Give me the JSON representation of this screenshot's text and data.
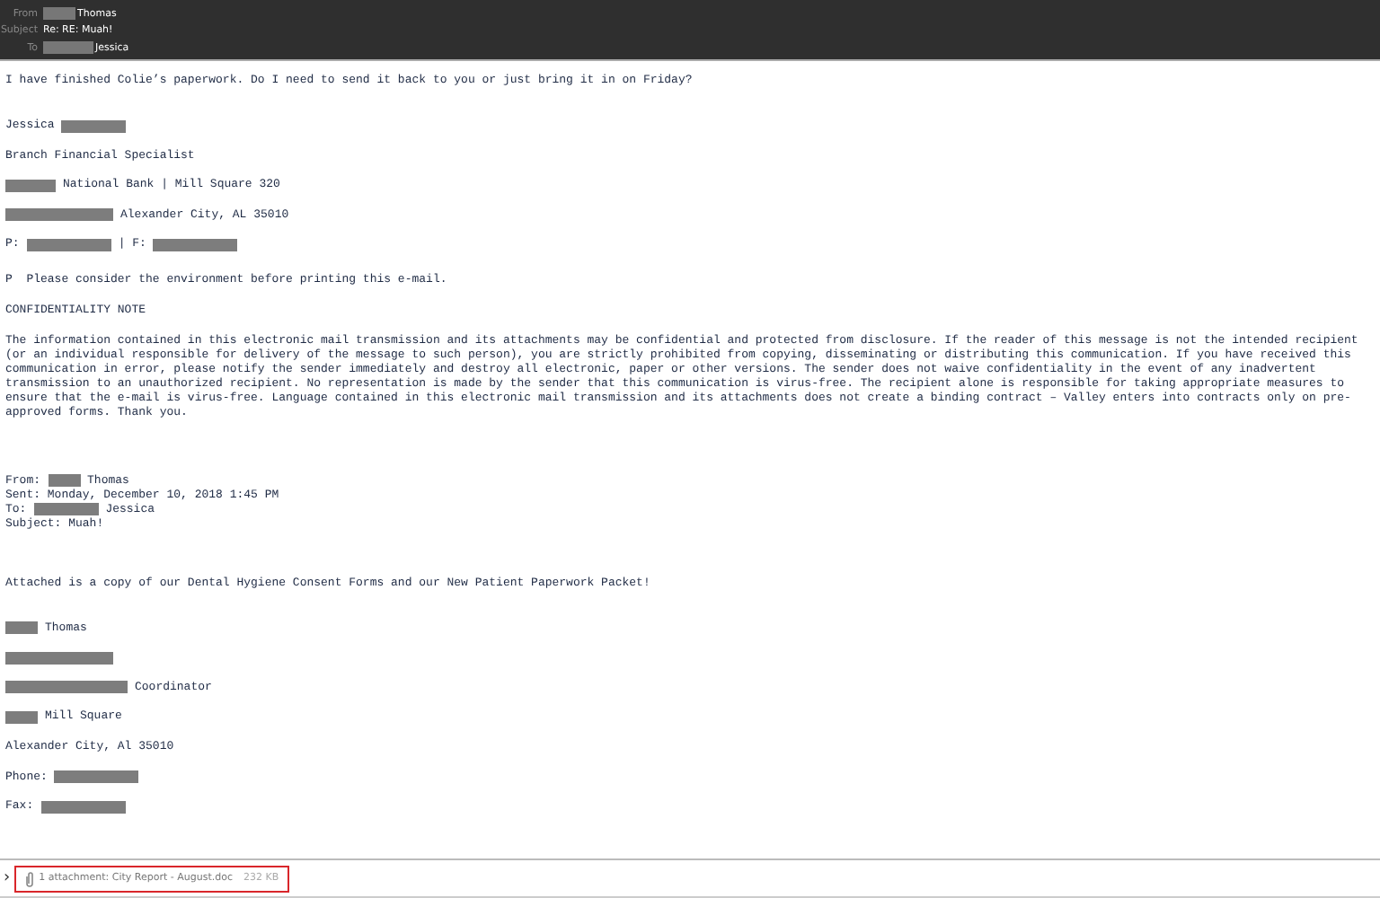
{
  "header": [
    {
      "label": "From",
      "parts": [
        {
          "kind": "small"
        },
        {
          "kind": "text",
          "text": "Thomas"
        }
      ]
    },
    {
      "label": "Subject",
      "parts": [
        {
          "kind": "text",
          "text": "Re: RE: Muah!"
        }
      ]
    },
    {
      "label": "To",
      "parts": [
        {
          "kind": "medium"
        },
        {
          "kind": "text",
          "text": "Jessica"
        }
      ]
    }
  ],
  "body": [
    {
      "kind": "spaced",
      "lines": [
        [
          {
            "kind": "text",
            "text": "I have finished Colie’s paperwork. Do I need to send it back to you or just bring it in on Friday?"
          }
        ]
      ]
    },
    {
      "kind": "spaced",
      "lines": [
        [
          {
            "kind": "text",
            "text": "Jessica"
          },
          {
            "kind": "large"
          }
        ],
        [
          {
            "kind": "text",
            "text": "Branch Financial Specialist"
          }
        ],
        [
          {
            "kind": "medium"
          },
          {
            "kind": "text",
            "text": "National Bank | Mill Square 320"
          }
        ],
        [
          {
            "kind": "wider"
          },
          {
            "kind": "text",
            "text": "Alexander City, AL 35010"
          }
        ],
        [
          {
            "kind": "text",
            "text": "P:"
          },
          {
            "kind": "wide"
          },
          {
            "kind": "text",
            "text": "| F:"
          },
          {
            "kind": "wide"
          }
        ]
      ]
    },
    {
      "kind": "spaced",
      "lines": [
        [
          {
            "kind": "text",
            "text": "P  Please consider the environment before printing this e-mail."
          }
        ],
        [
          {
            "kind": "text",
            "text": "CONFIDENTIALITY NOTE"
          }
        ]
      ]
    },
    {
      "kind": "paragraph",
      "lines": [
        "The information contained in this electronic mail transmission and its attachments may be confidential and protected from disclosure. If the reader of this message is not the intended recipient",
        "(or an individual responsible for delivery of the message to such person), you are strictly prohibited from copying, disseminating or distributing this communication. If you have received this",
        "communication in error, please notify the sender immediately and destroy all electronic, paper or other versions. The sender does not waive confidentiality in the event of any inadvertent",
        "transmission to an unauthorized recipient. No representation is made by the sender that this communication is virus-free. The recipient alone is responsible for taking appropriate measures to",
        "ensure that the e-mail is virus-free. Language contained in this electronic mail transmission and its attachments does not create a binding contract – Valley enters into contracts only on pre-",
        "approved forms. Thank you."
      ]
    },
    {
      "kind": "tight",
      "lines": [
        [
          {
            "kind": "text",
            "text": "From:"
          },
          {
            "kind": "small"
          },
          {
            "kind": "text",
            "text": "Thomas"
          }
        ],
        [
          {
            "kind": "text",
            "text": "Sent: Monday, December 10, 2018 1:45 PM"
          }
        ],
        [
          {
            "kind": "text",
            "text": "To:"
          },
          {
            "kind": "large"
          },
          {
            "kind": "text",
            "text": "Jessica"
          }
        ],
        [
          {
            "kind": "text",
            "text": "Subject: Muah!"
          }
        ]
      ]
    },
    {
      "kind": "spaced",
      "lines": [
        [
          {
            "kind": "text",
            "text": "Attached is a copy of our Dental Hygiene Consent Forms and our New Patient Paperwork Packet!"
          }
        ]
      ]
    },
    {
      "kind": "spaced",
      "lines": [
        [
          {
            "kind": "small"
          },
          {
            "kind": "text",
            "text": "Thomas"
          }
        ],
        [
          {
            "kind": "wider"
          }
        ],
        [
          {
            "kind": "widest"
          },
          {
            "kind": "text",
            "text": "Coordinator"
          }
        ],
        [
          {
            "kind": "small"
          },
          {
            "kind": "text",
            "text": "Mill Square"
          }
        ],
        [
          {
            "kind": "text",
            "text": "Alexander City, Al 35010"
          }
        ],
        [
          {
            "kind": "text",
            "text": "Phone:"
          },
          {
            "kind": "wide"
          }
        ],
        [
          {
            "kind": "text",
            "text": "Fax:"
          },
          {
            "kind": "wide"
          }
        ]
      ]
    }
  ],
  "attachment": {
    "toggle": "›",
    "label": "1 attachment: City Report - August.doc",
    "size": "232 KB",
    "highlighted": true
  }
}
